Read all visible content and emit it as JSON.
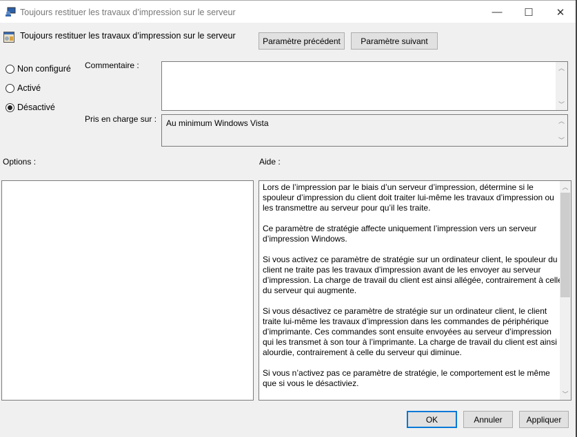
{
  "window": {
    "title": "Toujours restituer les travaux d’impression sur le serveur",
    "minimize": "—",
    "maximize": "☐",
    "close": "✕"
  },
  "header": {
    "title": "Toujours restituer les travaux d’impression sur le serveur",
    "prev_button": "Paramètre précédent",
    "next_button": "Paramètre suivant"
  },
  "state": {
    "options": [
      {
        "label": "Non configuré",
        "selected": false
      },
      {
        "label": "Activé",
        "selected": false
      },
      {
        "label": "Désactivé",
        "selected": true
      }
    ]
  },
  "comment": {
    "label": "Commentaire :",
    "value": ""
  },
  "supported": {
    "label": "Pris en charge sur :",
    "value": "Au minimum Windows Vista"
  },
  "options_label": "Options :",
  "help_label": "Aide :",
  "help_lines": [
    "Lors de l’impression par le biais d’un serveur d’impression, détermine si le",
    "spouleur d’impression du client doit traiter lui-même les travaux d’impression ou",
    "les transmettre au serveur pour qu’il les traite.",
    "",
    "Ce paramètre de stratégie affecte uniquement l’impression vers un serveur",
    "d’impression Windows.",
    "",
    "Si vous activez ce paramètre de stratégie sur un ordinateur client, le spouleur du",
    "client ne traite pas les travaux d’impression avant de les envoyer au serveur",
    "d’impression. La charge de travail du client est ainsi allégée, contrairement à celle",
    "du serveur qui augmente.",
    "",
    "Si vous désactivez ce paramètre de stratégie sur un ordinateur client, le client",
    "traite lui-même les travaux d’impression dans les commandes de périphérique",
    "d’imprimante. Ces commandes sont ensuite envoyées au serveur d’impression",
    "qui les transmet à son tour à l’imprimante. La charge de travail du client est ainsi",
    "alourdie, contrairement à celle du serveur qui diminue.",
    "",
    "Si vous n’activez pas ce paramètre de stratégie, le comportement est le même",
    "que si vous le désactiviez."
  ],
  "footer": {
    "ok": "OK",
    "cancel": "Annuler",
    "apply": "Appliquer"
  }
}
